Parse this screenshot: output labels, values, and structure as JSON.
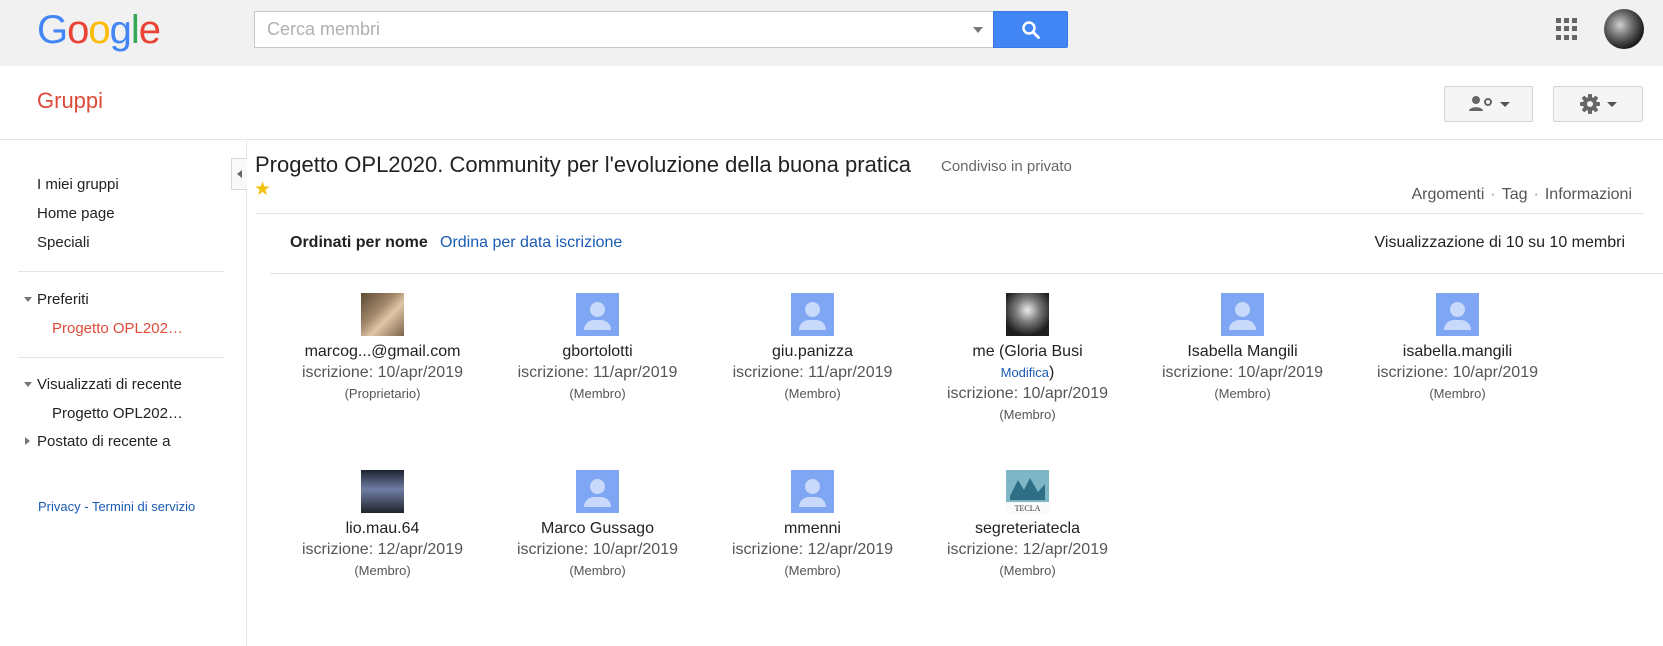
{
  "header": {
    "logo_letters": [
      {
        "char": "G",
        "color": "#4285f4"
      },
      {
        "char": "o",
        "color": "#ea4335"
      },
      {
        "char": "o",
        "color": "#fbbc05"
      },
      {
        "char": "g",
        "color": "#4285f4"
      },
      {
        "char": "l",
        "color": "#34a853"
      },
      {
        "char": "e",
        "color": "#ea4335"
      }
    ],
    "search_placeholder": "Cerca membri",
    "search_value": ""
  },
  "subheader": {
    "title": "Gruppi"
  },
  "sidebar": {
    "items": {
      "my_groups": "I miei gruppi",
      "home": "Home page",
      "special": "Speciali",
      "favorites": "Preferiti",
      "favorite_group": "Progetto OPL202…",
      "recent": "Visualizzati di recente",
      "recent_group": "Progetto OPL202…",
      "posted_recent": "Postato di recente a"
    },
    "footer": {
      "privacy": "Privacy",
      "sep": " - ",
      "terms": "Termini di servizio"
    }
  },
  "group": {
    "title": "Progetto OPL2020. Community per l'evoluzione della buona pratica",
    "visibility": "Condiviso in privato",
    "links": {
      "topics": "Argomenti",
      "tags": "Tag",
      "info": "Informazioni",
      "sep": "·"
    }
  },
  "sorting": {
    "active": "Ordinati per nome",
    "alternative": "Ordina per data iscrizione",
    "count": "Visualizzazione di 10 su 10 membri"
  },
  "members": [
    {
      "name": "marcog...@gmail.com",
      "joined": "iscrizione: 10/apr/2019",
      "role": "(Proprietario)",
      "avatar": "photo1"
    },
    {
      "name": "gbortolotti",
      "joined": "iscrizione: 11/apr/2019",
      "role": "(Membro)",
      "avatar": "default"
    },
    {
      "name": "giu.panizza",
      "joined": "iscrizione: 11/apr/2019",
      "role": "(Membro)",
      "avatar": "default"
    },
    {
      "name": "me  (Gloria Busi",
      "edit": "Modifica",
      "edit_close": ")",
      "joined": "iscrizione: 10/apr/2019",
      "role": "(Membro)",
      "avatar": "photo2"
    },
    {
      "name": "Isabella Mangili",
      "joined": "iscrizione: 10/apr/2019",
      "role": "(Membro)",
      "avatar": "default"
    },
    {
      "name": "isabella.mangili",
      "joined": "iscrizione: 10/apr/2019",
      "role": "(Membro)",
      "avatar": "default"
    },
    {
      "name": "lio.mau.64",
      "joined": "iscrizione: 12/apr/2019",
      "role": "(Membro)",
      "avatar": "photo3"
    },
    {
      "name": "Marco Gussago",
      "joined": "iscrizione: 10/apr/2019",
      "role": "(Membro)",
      "avatar": "default"
    },
    {
      "name": "mmenni",
      "joined": "iscrizione: 12/apr/2019",
      "role": "(Membro)",
      "avatar": "default"
    },
    {
      "name": "segreteriatecla",
      "joined": "iscrizione: 12/apr/2019",
      "role": "(Membro)",
      "avatar": "photo4",
      "avatar_caption": "TECLA"
    }
  ]
}
